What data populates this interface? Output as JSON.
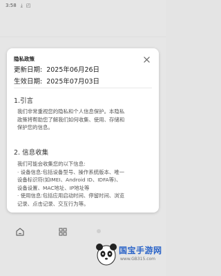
{
  "status_bar": {
    "time": "3:58",
    "icons": [
      "download-icon",
      "notification-icon"
    ]
  },
  "dialog": {
    "title": "隐私政策",
    "updated_label": "更新日期:",
    "updated_value": "2025年06月26日",
    "effective_label": "生效日期:",
    "effective_value": "2025年07月03日",
    "section1": {
      "heading": "1.引言",
      "lines": [
        "我们非常重视您的隐私和个人信息保护。本隐私",
        "政策将帮助您了解我们如何收集、使用、存储和",
        "保护您的信息。"
      ]
    },
    "section2": {
      "heading": "2. 信息收集",
      "lines": [
        "我们可能会收集您的以下信息:",
        "· 设备信息:包括设备型号、操作系统版本、唯一",
        "设备标识符(如IMEI、Android ID、IDFA等)、",
        "设备设置、MAC地址、IP地址等",
        "· 使用信息:包括应用启动时间、停留时间、浏览",
        "记录、点击记录、交互行为等。"
      ]
    }
  },
  "watermark": {
    "title": "国宝手游网",
    "url": "www.GB315.com"
  },
  "colors": {
    "accent": "#2a63c8",
    "dialog_bg": "#ffffff",
    "backdrop": "#e6e6e6"
  }
}
